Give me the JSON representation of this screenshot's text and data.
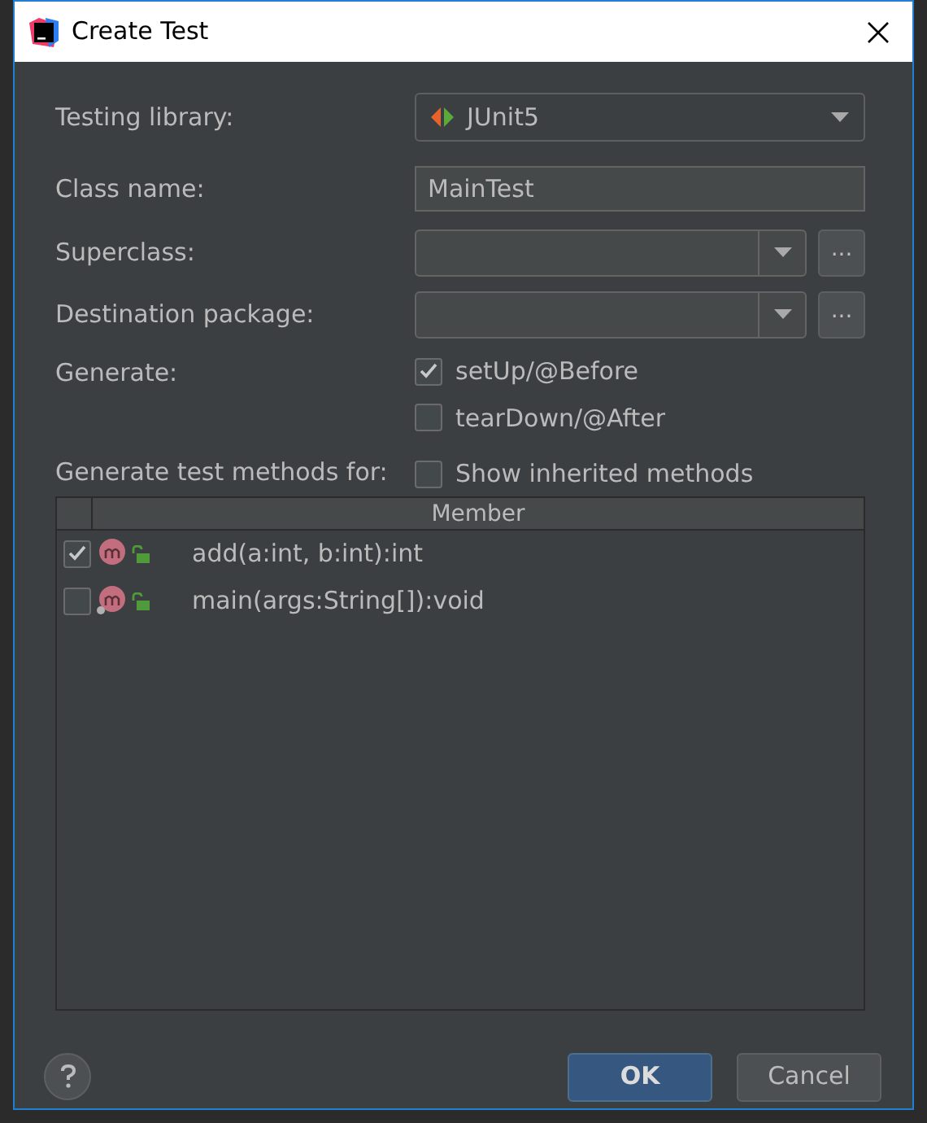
{
  "window": {
    "title": "Create Test"
  },
  "testing_library": {
    "label": "Testing library:",
    "value": "JUnit5"
  },
  "class_name": {
    "label": "Class name:",
    "value": "MainTest"
  },
  "superclass": {
    "label": "Superclass:",
    "browse": "..."
  },
  "destination_package": {
    "label": "Destination package:",
    "browse": "..."
  },
  "generate": {
    "label": "Generate:",
    "options": [
      {
        "label": "setUp/@Before",
        "checked": true
      },
      {
        "label": "tearDown/@After",
        "checked": false
      }
    ]
  },
  "generate_methods": {
    "label": "Generate test methods for:",
    "show_inherited": {
      "label": "Show inherited methods",
      "checked": false
    }
  },
  "table": {
    "columns": [
      "Member"
    ],
    "rows": [
      {
        "member": "add(a:int, b:int):int",
        "checked": true,
        "static": false
      },
      {
        "member": "main(args:String[]):void",
        "checked": false,
        "static": true
      }
    ]
  },
  "buttons": [
    {
      "label": "OK",
      "kind": "primary"
    },
    {
      "label": "Cancel",
      "kind": "secondary"
    }
  ]
}
